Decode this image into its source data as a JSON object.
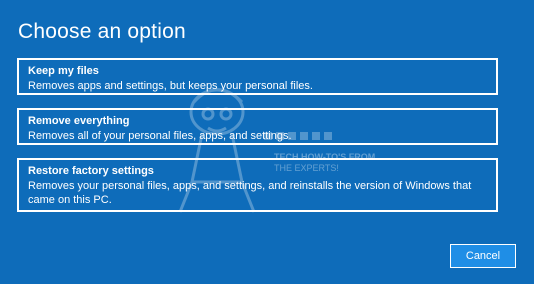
{
  "title": "Choose an option",
  "options": [
    {
      "title": "Keep my files",
      "description": "Removes apps and settings, but keeps your personal files."
    },
    {
      "title": "Remove everything",
      "description": "Removes all of your personal files, apps, and settings."
    },
    {
      "title": "Restore factory settings",
      "description": "Removes your personal files, apps, and settings, and reinstalls the version of Windows that came on this PC."
    }
  ],
  "cancel_label": "Cancel",
  "watermark": {
    "line1": "TECH HOW-TO'S FROM",
    "line2": "THE EXPERTS!"
  },
  "colors": {
    "background": "#0e6cba",
    "button_fill": "#1f8ee6",
    "text": "#ffffff"
  }
}
